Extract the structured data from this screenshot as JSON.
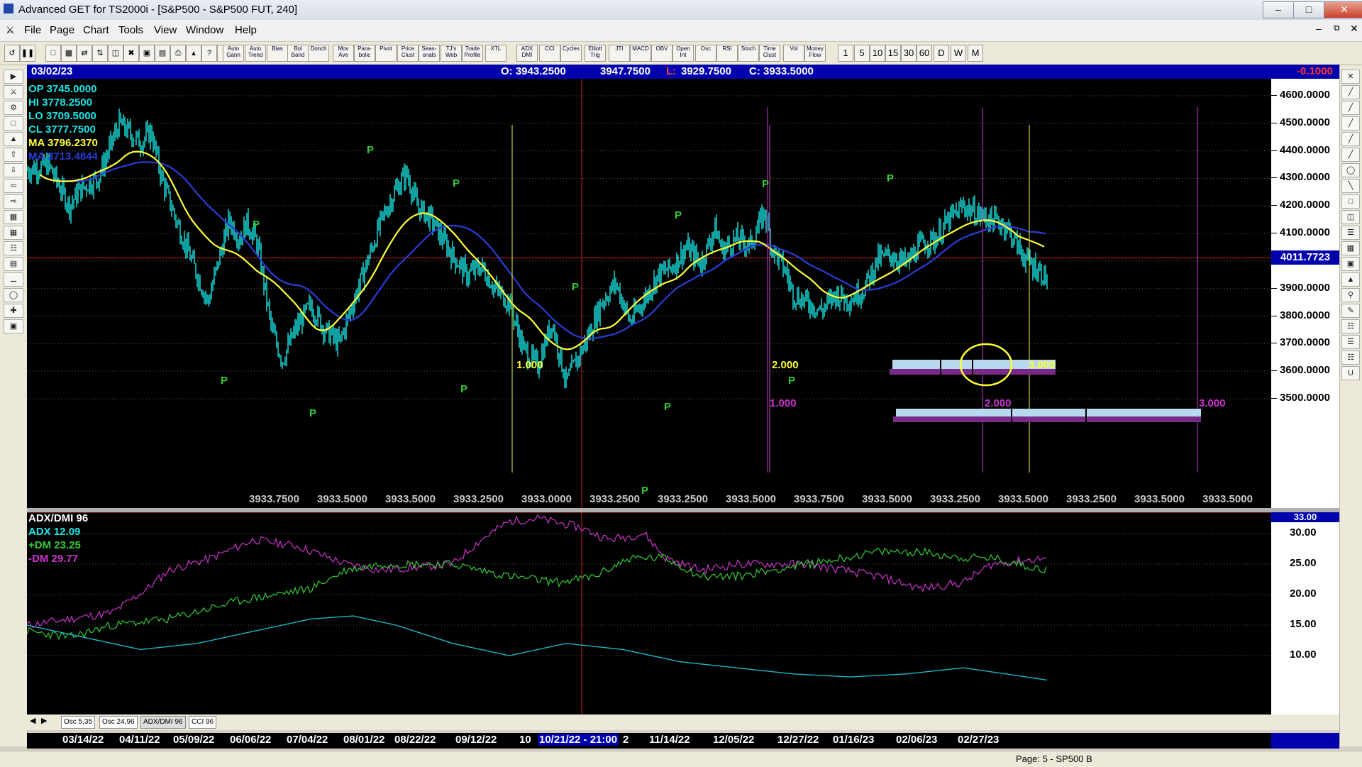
{
  "window": {
    "title": "Advanced GET for TS2000i - [S&P500 - S&P500 FUT, 240]"
  },
  "menu": [
    "File",
    "Page",
    "Chart",
    "Tools",
    "View",
    "Window",
    "Help"
  ],
  "toolbar": {
    "studies": [
      "Auto Gann",
      "Auto Trend",
      "Bias",
      "Bol Band",
      "Donch",
      "Mov Ave",
      "Para- bolic",
      "Pivot",
      "Price Clust",
      "Seas- onals",
      "TJ's Web",
      "Trade Profile",
      "XTL",
      "ADX DMI",
      "CCI",
      "Cycles",
      "Elliott Trig",
      "JTI",
      "MACD",
      "OBV",
      "Open Int",
      "Osc",
      "RSI",
      "Stoch",
      "Time Clust",
      "Vol",
      "Money Flow"
    ],
    "intervals": [
      "1",
      "5",
      "10",
      "15",
      "30",
      "60",
      "D",
      "W",
      "M"
    ]
  },
  "infobar": {
    "date": "03/02/23",
    "open": "O: 3943.2500",
    "high": "3947.7500",
    "low_label": "L:",
    "low": "3929.7500",
    "close": "C: 3933.5000",
    "change": "-0.1000"
  },
  "legend": [
    {
      "text": "OP  3745.0000",
      "color": "#19e6e6"
    },
    {
      "text": "HI  3778.2500",
      "color": "#19e6e6"
    },
    {
      "text": "LO  3709.5000",
      "color": "#19e6e6"
    },
    {
      "text": "CL  3777.7500",
      "color": "#19e6e6"
    },
    {
      "text": "MA  3796.2370",
      "color": "#ffff33"
    },
    {
      "text": "MA  3713.4844",
      "color": "#2a3cd8"
    }
  ],
  "price_axis": {
    "ticks": [
      "4600.0000",
      "4500.0000",
      "4400.0000",
      "4300.0000",
      "4200.0000",
      "4100.0000",
      "3900.0000",
      "3800.0000",
      "3700.0000",
      "3600.0000",
      "3500.0000"
    ],
    "current": "4011.7723",
    "top_value": "33.00"
  },
  "bottom_values": [
    "3933.7500",
    "3933.5000",
    "3933.5000",
    "3933.2500",
    "3933.0000",
    "3933.2500",
    "3933.2500",
    "3933.5000",
    "3933.7500",
    "3933.5000",
    "3933.2500",
    "3933.5000",
    "3933.2500",
    "3933.5000",
    "3933.5000"
  ],
  "cycle_labels": {
    "yellow": [
      "1.000",
      "2.000",
      "3.000"
    ],
    "magenta": [
      "1.000",
      "2.000",
      "3.000"
    ]
  },
  "pivot_label": "P",
  "sub": {
    "title": "ADX/DMI 96",
    "adx": "ADX 12.09",
    "pdm": "+DM 23.25",
    "mdm": "-DM 29.77",
    "ticks": [
      "30.00",
      "25.00",
      "20.00",
      "15.00",
      "10.00"
    ]
  },
  "tabs": [
    "Osc 5,35",
    "Osc 24,96",
    "ADX/DMI 96",
    "CCI 96"
  ],
  "dates": [
    "03/14/22",
    "04/11/22",
    "05/09/22",
    "06/06/22",
    "07/04/22",
    "08/01/22",
    "08/22/22",
    "09/12/22",
    "10",
    "10/21/22 - 21:00",
    "2",
    "11/14/22",
    "12/05/22",
    "12/27/22",
    "01/16/23",
    "02/06/23",
    "02/27/23"
  ],
  "status": "Page: 5 - SP500 B",
  "colors": {
    "cyan": "#19e6e6",
    "yellow": "#ffff33",
    "blue": "#2a3cd8",
    "magenta": "#cc33cc",
    "green": "#33cc33",
    "red": "#cc2222"
  }
}
